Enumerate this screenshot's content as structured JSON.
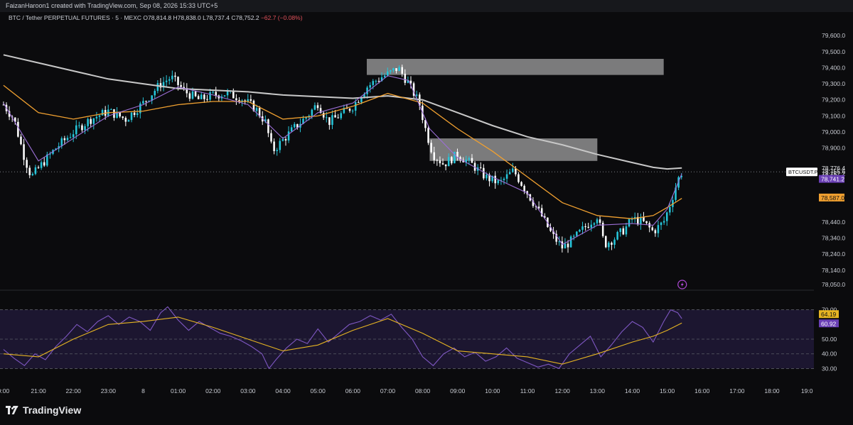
{
  "header": {
    "credit": "FaizanHaroon1 created with TradingView.com, Sep 08, 2026 15:33 UTC+5"
  },
  "symbol": {
    "name": "BTC / Tether PERPETUAL FUTURES · 5 · MEXC",
    "o_label": "O",
    "o": "78,814.8",
    "h_label": "H",
    "h": "78,838.0",
    "l_label": "L",
    "l": "78,737.4",
    "c_label": "C",
    "c": "78,752.2",
    "change": "−62.7 (−0.08%)"
  },
  "brand": {
    "name": "TradingView"
  },
  "colors": {
    "background": "#0b0b0d",
    "up": "#26c6da",
    "down": "#ffffff",
    "ma_short": "#9c6fd6",
    "ma_mid": "#f0a030",
    "ma_long": "#c8c8c8",
    "rsi": "#7e57c2",
    "rsi_ma": "#e6b422",
    "zone": "#d9d9d9"
  },
  "chart_data": [
    {
      "type": "candlestick",
      "title": "",
      "price_labels": [
        "79,600.0",
        "79,500.0",
        "79,400.0",
        "79,300.0",
        "79,200.0",
        "79,100.0",
        "79,000.0",
        "78,900.0",
        "78,440.0",
        "78,340.0",
        "78,240.0",
        "78,140.0",
        "78,050.0"
      ],
      "price_ticks": [
        79600,
        79500,
        79400,
        79300,
        79200,
        79100,
        79000,
        78900,
        78440,
        78340,
        78240,
        78140,
        78050
      ],
      "ylim": [
        78020,
        79680
      ],
      "time_labels": [
        "0:00",
        "21:00",
        "22:00",
        "23:00",
        "8",
        "01:00",
        "02:00",
        "03:00",
        "04:00",
        "05:00",
        "06:00",
        "07:00",
        "08:00",
        "09:00",
        "10:00",
        "11:00",
        "12:00",
        "13:00",
        "14:00",
        "15:00",
        "16:00",
        "17:00",
        "18:00",
        "19:0"
      ],
      "time_ticks": [
        20,
        21,
        22,
        23,
        24,
        25,
        26,
        27,
        28,
        29,
        30,
        31,
        32,
        33,
        34,
        35,
        36,
        37,
        38,
        39,
        40,
        41,
        42,
        43
      ],
      "xlim": [
        19.9,
        43.2
      ],
      "last_time": 39.42,
      "price_anchors": [
        [
          20.0,
          79170
        ],
        [
          20.3,
          79080
        ],
        [
          20.6,
          78840
        ],
        [
          20.8,
          78720
        ],
        [
          21.1,
          78800
        ],
        [
          21.5,
          78900
        ],
        [
          22.0,
          79000
        ],
        [
          22.5,
          79080
        ],
        [
          23.0,
          79130
        ],
        [
          23.5,
          79080
        ],
        [
          24.0,
          79180
        ],
        [
          24.5,
          79300
        ],
        [
          24.8,
          79340
        ],
        [
          25.2,
          79250
        ],
        [
          25.6,
          79200
        ],
        [
          26.0,
          79230
        ],
        [
          26.4,
          79240
        ],
        [
          26.8,
          79210
        ],
        [
          27.2,
          79150
        ],
        [
          27.5,
          79060
        ],
        [
          27.7,
          78880
        ],
        [
          28.0,
          78950
        ],
        [
          28.3,
          79020
        ],
        [
          28.7,
          79100
        ],
        [
          29.0,
          79180
        ],
        [
          29.3,
          79060
        ],
        [
          29.6,
          79100
        ],
        [
          30.0,
          79160
        ],
        [
          30.4,
          79280
        ],
        [
          30.8,
          79340
        ],
        [
          31.0,
          79360
        ],
        [
          31.3,
          79400
        ],
        [
          31.6,
          79300
        ],
        [
          31.9,
          79180
        ],
        [
          32.1,
          79000
        ],
        [
          32.3,
          78860
        ],
        [
          32.6,
          78800
        ],
        [
          33.0,
          78860
        ],
        [
          33.4,
          78800
        ],
        [
          33.8,
          78720
        ],
        [
          34.2,
          78680
        ],
        [
          34.6,
          78760
        ],
        [
          35.0,
          78620
        ],
        [
          35.4,
          78480
        ],
        [
          35.7,
          78360
        ],
        [
          36.0,
          78280
        ],
        [
          36.3,
          78330
        ],
        [
          36.7,
          78420
        ],
        [
          37.0,
          78480
        ],
        [
          37.2,
          78300
        ],
        [
          37.5,
          78340
        ],
        [
          37.8,
          78400
        ],
        [
          38.0,
          78460
        ],
        [
          38.3,
          78440
        ],
        [
          38.6,
          78380
        ],
        [
          38.9,
          78440
        ],
        [
          39.1,
          78560
        ],
        [
          39.3,
          78700
        ],
        [
          39.42,
          78752
        ]
      ],
      "ma_short": [
        [
          20.0,
          79180
        ],
        [
          21.0,
          78820
        ],
        [
          22.0,
          78960
        ],
        [
          23.0,
          79100
        ],
        [
          24.0,
          79170
        ],
        [
          25.0,
          79280
        ],
        [
          26.0,
          79230
        ],
        [
          27.0,
          79170
        ],
        [
          28.0,
          78960
        ],
        [
          29.0,
          79120
        ],
        [
          30.0,
          79180
        ],
        [
          31.0,
          79350
        ],
        [
          31.6,
          79320
        ],
        [
          32.2,
          79020
        ],
        [
          33.0,
          78840
        ],
        [
          34.0,
          78720
        ],
        [
          35.0,
          78620
        ],
        [
          36.0,
          78300
        ],
        [
          37.0,
          78420
        ],
        [
          38.0,
          78430
        ],
        [
          38.6,
          78420
        ],
        [
          39.0,
          78520
        ],
        [
          39.42,
          78741
        ]
      ],
      "ma_mid": [
        [
          20.0,
          79290
        ],
        [
          21.0,
          79120
        ],
        [
          22.0,
          79080
        ],
        [
          23.0,
          79120
        ],
        [
          24.0,
          79130
        ],
        [
          25.0,
          79170
        ],
        [
          26.0,
          79190
        ],
        [
          27.0,
          79190
        ],
        [
          28.0,
          79080
        ],
        [
          29.0,
          79100
        ],
        [
          30.0,
          79160
        ],
        [
          31.0,
          79240
        ],
        [
          32.0,
          79180
        ],
        [
          33.0,
          79020
        ],
        [
          34.0,
          78880
        ],
        [
          35.0,
          78720
        ],
        [
          36.0,
          78560
        ],
        [
          37.0,
          78480
        ],
        [
          38.0,
          78460
        ],
        [
          38.6,
          78480
        ],
        [
          39.0,
          78530
        ],
        [
          39.42,
          78587
        ]
      ],
      "ma_long": [
        [
          20.0,
          79480
        ],
        [
          21.0,
          79430
        ],
        [
          22.0,
          79380
        ],
        [
          23.0,
          79330
        ],
        [
          24.0,
          79300
        ],
        [
          25.0,
          79270
        ],
        [
          26.0,
          79260
        ],
        [
          27.0,
          79250
        ],
        [
          28.0,
          79230
        ],
        [
          29.0,
          79220
        ],
        [
          30.0,
          79210
        ],
        [
          31.0,
          79225
        ],
        [
          32.0,
          79200
        ],
        [
          33.0,
          79120
        ],
        [
          34.0,
          79040
        ],
        [
          35.0,
          78970
        ],
        [
          36.0,
          78920
        ],
        [
          37.0,
          78860
        ],
        [
          38.0,
          78810
        ],
        [
          38.6,
          78780
        ],
        [
          39.0,
          78770
        ],
        [
          39.42,
          78776
        ]
      ],
      "zones": [
        {
          "x0": 30.4,
          "x1": 38.9,
          "y0": 79355,
          "y1": 79455
        },
        {
          "x0": 32.2,
          "x1": 37.0,
          "y0": 78820,
          "y1": 78960
        }
      ],
      "right_labels": [
        {
          "text": "78,776.4",
          "price": 78776,
          "style": "plain"
        },
        {
          "text": "78,755.6",
          "price": 78755,
          "style": "plain"
        },
        {
          "text": "78,752.2",
          "price": 78740,
          "style": "plain"
        },
        {
          "text": "01:57",
          "price": 78725,
          "style": "plain"
        },
        {
          "text": "78,741.2",
          "price": 78706,
          "style": "purple"
        },
        {
          "text": "78,587.0",
          "price": 78590,
          "style": "orange"
        }
      ],
      "symbol_tag": "BTCUSDT.P"
    },
    {
      "type": "line",
      "title": "",
      "ticks": [
        70,
        50,
        40,
        30
      ],
      "tick_labels": [
        "70.00",
        "50.00",
        "40.00",
        "30.00"
      ],
      "ylim": [
        22,
        78
      ],
      "band": [
        30,
        70
      ],
      "rsi": [
        [
          20.0,
          43
        ],
        [
          20.3,
          37
        ],
        [
          20.6,
          32
        ],
        [
          20.9,
          40
        ],
        [
          21.2,
          36
        ],
        [
          21.5,
          45
        ],
        [
          21.8,
          52
        ],
        [
          22.1,
          60
        ],
        [
          22.4,
          55
        ],
        [
          22.7,
          62
        ],
        [
          23.0,
          66
        ],
        [
          23.3,
          60
        ],
        [
          23.6,
          65
        ],
        [
          23.9,
          62
        ],
        [
          24.2,
          56
        ],
        [
          24.5,
          68
        ],
        [
          24.7,
          72
        ],
        [
          25.0,
          63
        ],
        [
          25.3,
          56
        ],
        [
          25.6,
          62
        ],
        [
          25.9,
          58
        ],
        [
          26.2,
          54
        ],
        [
          26.5,
          52
        ],
        [
          26.8,
          49
        ],
        [
          27.1,
          45
        ],
        [
          27.4,
          40
        ],
        [
          27.6,
          30
        ],
        [
          27.8,
          36
        ],
        [
          28.1,
          44
        ],
        [
          28.4,
          50
        ],
        [
          28.7,
          47
        ],
        [
          29.0,
          57
        ],
        [
          29.3,
          48
        ],
        [
          29.6,
          54
        ],
        [
          29.9,
          60
        ],
        [
          30.2,
          62
        ],
        [
          30.5,
          66
        ],
        [
          30.8,
          63
        ],
        [
          31.1,
          67
        ],
        [
          31.4,
          58
        ],
        [
          31.7,
          50
        ],
        [
          32.0,
          38
        ],
        [
          32.3,
          32
        ],
        [
          32.6,
          40
        ],
        [
          32.9,
          44
        ],
        [
          33.2,
          38
        ],
        [
          33.5,
          41
        ],
        [
          33.8,
          35
        ],
        [
          34.1,
          38
        ],
        [
          34.4,
          44
        ],
        [
          34.7,
          37
        ],
        [
          35.0,
          34
        ],
        [
          35.3,
          31
        ],
        [
          35.6,
          33
        ],
        [
          35.9,
          30
        ],
        [
          36.2,
          40
        ],
        [
          36.5,
          46
        ],
        [
          36.8,
          52
        ],
        [
          37.1,
          38
        ],
        [
          37.4,
          46
        ],
        [
          37.7,
          55
        ],
        [
          38.0,
          62
        ],
        [
          38.3,
          58
        ],
        [
          38.6,
          48
        ],
        [
          38.9,
          62
        ],
        [
          39.1,
          70
        ],
        [
          39.3,
          68
        ],
        [
          39.42,
          64
        ]
      ],
      "rsi_ma": [
        [
          20.0,
          40
        ],
        [
          21.0,
          38
        ],
        [
          22.0,
          50
        ],
        [
          23.0,
          60
        ],
        [
          24.0,
          62
        ],
        [
          25.0,
          65
        ],
        [
          26.0,
          58
        ],
        [
          27.0,
          50
        ],
        [
          28.0,
          42
        ],
        [
          29.0,
          46
        ],
        [
          30.0,
          56
        ],
        [
          31.0,
          64
        ],
        [
          32.0,
          54
        ],
        [
          33.0,
          42
        ],
        [
          34.0,
          40
        ],
        [
          35.0,
          38
        ],
        [
          36.0,
          33
        ],
        [
          37.0,
          40
        ],
        [
          38.0,
          48
        ],
        [
          38.6,
          52
        ],
        [
          39.0,
          56
        ],
        [
          39.42,
          61
        ]
      ],
      "right_labels": [
        {
          "text": "64.19",
          "value": 66.8,
          "style": "yellow"
        },
        {
          "text": "60.92",
          "value": 60.5,
          "style": "purple"
        }
      ]
    }
  ]
}
